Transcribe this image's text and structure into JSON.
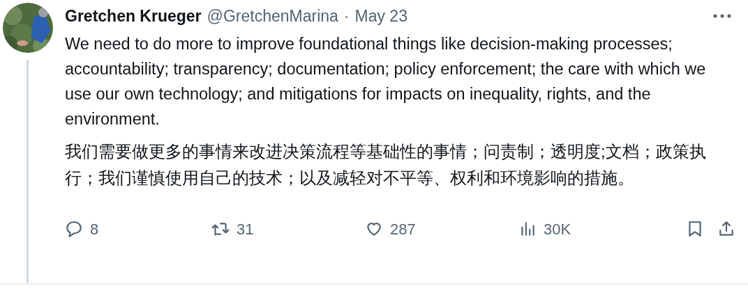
{
  "author": {
    "name": "Gretchen Krueger",
    "handle": "@GretchenMarina",
    "separator": "·",
    "date": "May 23"
  },
  "paragraphs": [
    "We need to do more to improve foundational things like decision-making processes; accountability; transparency; documentation; policy enforcement; the care with which we use our own technology; and mitigations for impacts on inequality, rights, and the environment.",
    "我们需要做更多的事情来改进决策流程等基础性的事情；问责制；透明度;文档；政策执行；我们谨慎使用自己的技术；以及减轻对不平等、权利和环境影响的措施。"
  ],
  "actions": [
    {
      "kind": "reply",
      "count": "8"
    },
    {
      "kind": "retweet",
      "count": "31"
    },
    {
      "kind": "like",
      "count": "287"
    },
    {
      "kind": "views",
      "count": "30K"
    },
    {
      "kind": "bookmark"
    },
    {
      "kind": "share"
    }
  ]
}
